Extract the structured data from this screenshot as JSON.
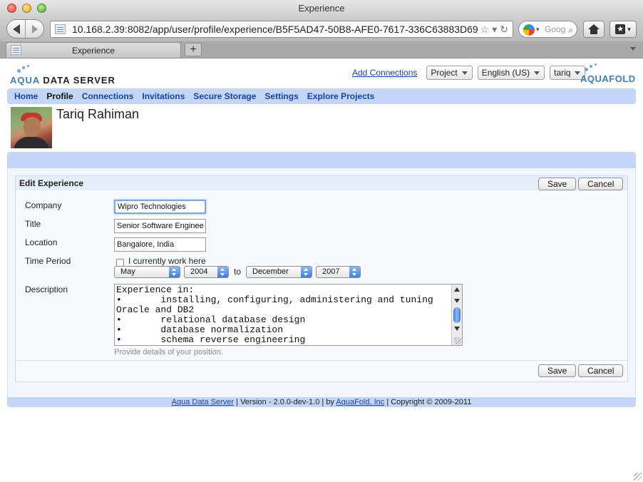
{
  "window": {
    "title": "Experience"
  },
  "browser": {
    "url": "10.168.2.39:8082/app/user/profile/experience/B5F5AD47-50B8-AFE0-7617-336C63883D69",
    "search_placeholder": "Goog",
    "tab_title": "Experience",
    "new_tab_label": "+"
  },
  "header": {
    "logo_left_aqua": "AQUA",
    "logo_left_rest": " DATA SERVER",
    "add_connections": "Add Connections",
    "project_select": "Project",
    "language_select": "English (US)",
    "user_select": "tariq",
    "logo_right": "AQUAFOLD"
  },
  "nav": {
    "items": [
      {
        "label": "Home"
      },
      {
        "label": "Profile"
      },
      {
        "label": "Connections"
      },
      {
        "label": "Invitations"
      },
      {
        "label": "Secure Storage"
      },
      {
        "label": "Settings"
      },
      {
        "label": "Explore Projects"
      }
    ],
    "active": "Profile"
  },
  "profile": {
    "name": "Tariq Rahiman"
  },
  "form": {
    "title": "Edit Experience",
    "save_label": "Save",
    "cancel_label": "Cancel",
    "company_label": "Company",
    "company_value": "Wipro Technologies",
    "title_label": "Title",
    "title_value": "Senior Software Enginee",
    "location_label": "Location",
    "location_value": "Bangalore, India",
    "period_label": "Time Period",
    "current_label": "I currently work here",
    "start_month": "May",
    "start_year": "2004",
    "to_label": "to",
    "end_month": "December",
    "end_year": "2007",
    "description_label": "Description",
    "description_value": "Experience in:\n•       installing, configuring, administering and tuning\nOracle and DB2\n•       relational database design\n•       database normalization\n•       schema reverse engineering",
    "description_hint": "Provide details of your position."
  },
  "footer": {
    "product_link": "Aqua Data Server",
    "version_text": " | Version - 2.0.0-dev-1.0 | by ",
    "company_link": "AquaFold, Inc",
    "copyright_text": " | Copyright © 2009-2011"
  },
  "colors": {
    "nav_band": "#c4d6f5",
    "link": "#1a3fb5",
    "logo_blue": "#3c7fc0"
  }
}
